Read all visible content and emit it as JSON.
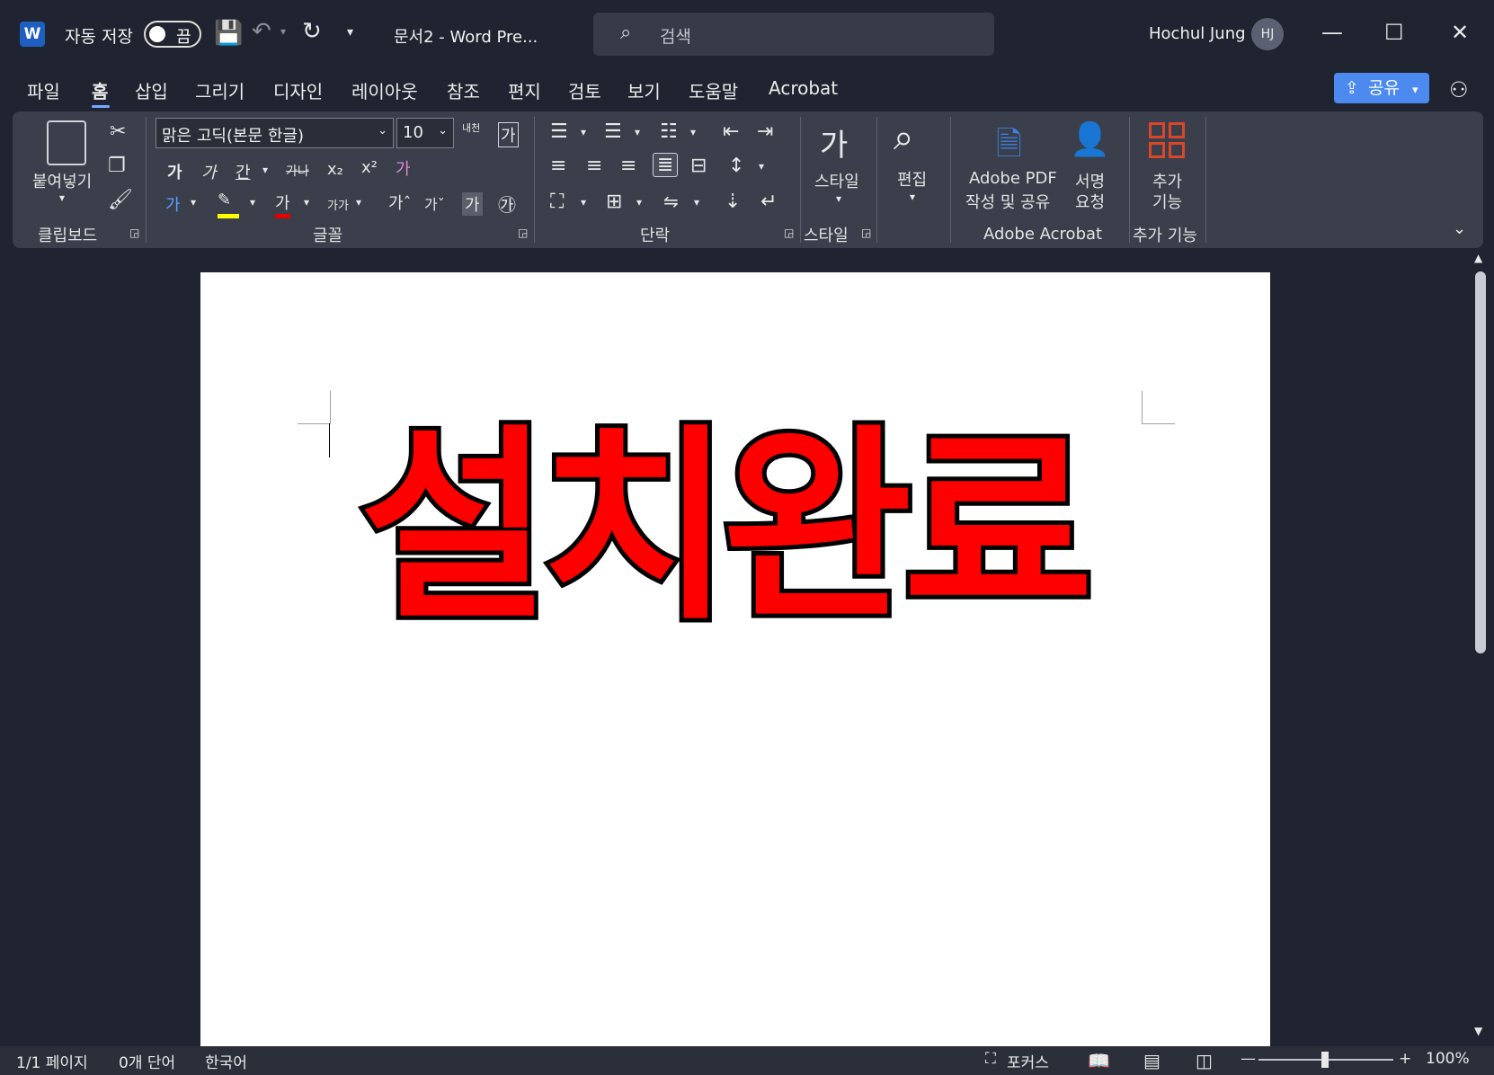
{
  "window": {
    "app_icon": "W",
    "autosave_label": "자동 저장",
    "autosave_state": "끔",
    "doc_title": "문서2  -  Word Pre...",
    "search_placeholder": "검색",
    "user_name": "Hochul Jung",
    "user_initials": "HJ",
    "minimize": "—",
    "maximize": "☐",
    "close": "✕"
  },
  "menu": {
    "tabs": [
      "파일",
      "홈",
      "삽입",
      "그리기",
      "디자인",
      "레이아웃",
      "참조",
      "편지",
      "검토",
      "보기",
      "도움말",
      "Acrobat"
    ],
    "active_tab": "홈",
    "share_label": "공유"
  },
  "ribbon": {
    "clipboard": {
      "paste": "붙여넣기",
      "group": "클립보드"
    },
    "font": {
      "font_name": "맑은 고딕(본문 한글)",
      "font_size": "10",
      "phonetic": "내천",
      "bold": "가",
      "italic": "가",
      "underline": "간",
      "strike": "가나",
      "subscript": "x₂",
      "superscript": "x²",
      "clear": "가",
      "font_color": "가",
      "case": "가가",
      "grow": "가ˆ",
      "shrink": "가ˇ",
      "char_shade": "가",
      "enclose": "㉮",
      "box": "가",
      "group": "글꼴"
    },
    "paragraph": {
      "group": "단락"
    },
    "styles": {
      "label": "스타일",
      "group": "스타일"
    },
    "editing": {
      "label": "편집"
    },
    "acrobat": {
      "create_pdf_line1": "Adobe PDF",
      "create_pdf_line2": "작성 및 공유",
      "sign_line1": "서명",
      "sign_line2": "요청",
      "group": "Adobe Acrobat"
    },
    "addins": {
      "line1": "추가",
      "line2": "기능",
      "group": "추가 기능"
    }
  },
  "document": {
    "headline": "설치완료",
    "headline_color": "#ff0000",
    "outline_color": "#000000"
  },
  "status": {
    "page": "1/1 페이지",
    "words": "0개 단어",
    "language": "한국어",
    "focus": "포커스",
    "zoom": "100%",
    "zoom_minus": "—",
    "zoom_plus": "+"
  },
  "colors": {
    "accent": "#4d8af0",
    "background": "#1f2430",
    "ribbon": "#3a3f4b"
  }
}
